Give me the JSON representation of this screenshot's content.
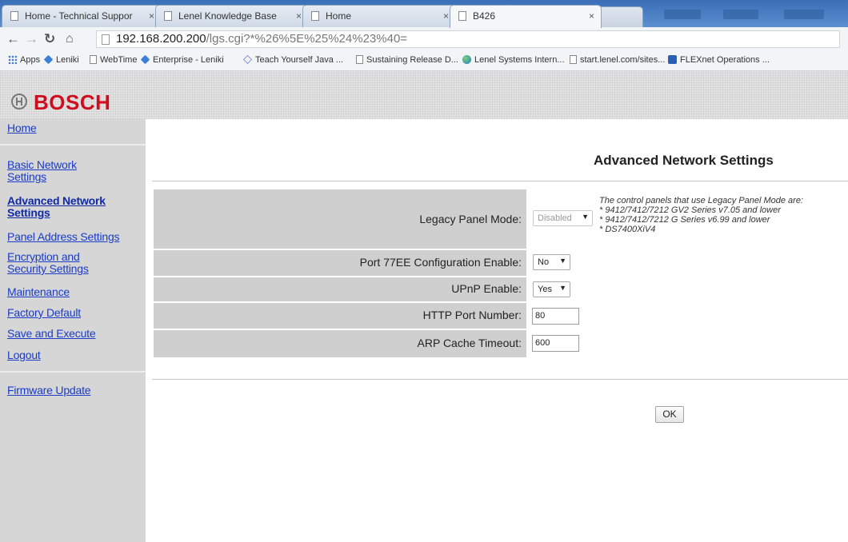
{
  "browser": {
    "tabs": [
      {
        "title": "Home - Technical Suppor",
        "active": false
      },
      {
        "title": "Lenel Knowledge Base",
        "active": false
      },
      {
        "title": "Home",
        "active": false
      },
      {
        "title": "B426",
        "active": true
      }
    ],
    "close_glyph": "×",
    "url_host": "192.168.200.200",
    "url_path": "/lgs.cgi?*%26%5E%25%24%23%40=",
    "bookmarks": [
      {
        "label": "Apps",
        "icon": "apps-icon"
      },
      {
        "label": "Leniki",
        "icon": "diamond-icon"
      },
      {
        "label": "WebTime",
        "icon": "page-icon"
      },
      {
        "label": "Enterprise - Leniki",
        "icon": "diamond-icon"
      },
      {
        "label": "Teach Yourself Java ...",
        "icon": "outline-diamond-icon"
      },
      {
        "label": "Sustaining Release D...",
        "icon": "page-icon"
      },
      {
        "label": "Lenel Systems Intern...",
        "icon": "globe-icon"
      },
      {
        "label": "start.lenel.com/sites...",
        "icon": "page-icon"
      },
      {
        "label": "FLEXnet Operations ...",
        "icon": "flexnet-icon"
      }
    ]
  },
  "brand": {
    "name": "BOSCH",
    "color": "#d00d1e"
  },
  "sidebar": {
    "items": [
      {
        "label": "Home"
      },
      {
        "label": "Basic Network Settings",
        "lines": [
          "Basic Network",
          "Settings"
        ]
      },
      {
        "label": "Advanced Network Settings",
        "lines": [
          "Advanced Network",
          "Settings"
        ],
        "current": true
      },
      {
        "label": "Panel Address Settings"
      },
      {
        "label": "Encryption and Security Settings",
        "lines": [
          "Encryption and",
          "Security Settings"
        ]
      },
      {
        "label": "Maintenance"
      },
      {
        "label": "Factory Default"
      },
      {
        "label": "Save and Execute"
      },
      {
        "label": "Logout"
      },
      {
        "label": "Firmware Update"
      }
    ]
  },
  "main": {
    "title": "Advanced Network Settings",
    "settings": [
      {
        "label": "Legacy Panel Mode:",
        "type": "select",
        "value": "Disabled",
        "disabled": true
      },
      {
        "label": "Port 77EE Configuration Enable:",
        "type": "select",
        "value": "No"
      },
      {
        "label": "UPnP Enable:",
        "type": "select",
        "value": "Yes"
      },
      {
        "label": "HTTP Port Number:",
        "type": "text",
        "value": "80"
      },
      {
        "label": "ARP Cache Timeout:",
        "type": "text",
        "value": "600"
      }
    ],
    "legacy_note": [
      "The control panels that use Legacy Panel Mode are:",
      "* 9412/7412/7212 GV2 Series v7.05 and lower",
      "* 9412/7412/7212 G Series v6.99 and lower",
      "* DS7400XiV4"
    ],
    "ok_label": "OK"
  },
  "colors": {
    "link": "#1a3cc8",
    "sidebar_bg": "#d6d6d6",
    "label_cell_bg": "#cfcfcf"
  }
}
